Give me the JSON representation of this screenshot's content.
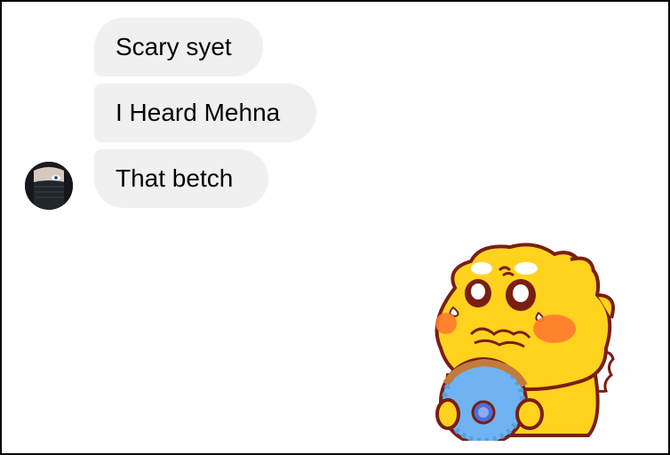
{
  "messages": [
    {
      "text": "Scary syet"
    },
    {
      "text": "I Heard Mehna"
    },
    {
      "text": "That betch"
    }
  ],
  "sender": {
    "avatar": "avatar-photo"
  },
  "sticker": {
    "icon": "crying-chick-sticker-icon",
    "colors": {
      "body": "#FFD21E",
      "outline": "#7A1E12",
      "cheek": "#FF7A2E",
      "donut": "#6FB3F2"
    }
  },
  "colors": {
    "bubble_bg": "#F0F0F0",
    "text": "#050505",
    "frame_border": "#000000"
  }
}
